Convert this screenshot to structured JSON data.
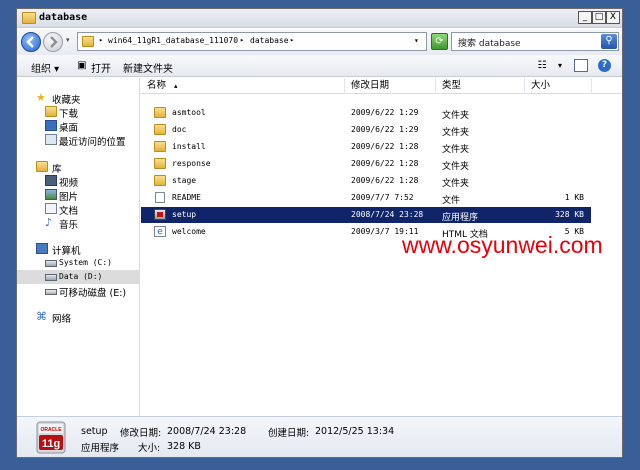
{
  "window": {
    "title": "database",
    "minimize": "_",
    "maximize": "□",
    "close": "X"
  },
  "address": {
    "segments": [
      "win64_11gR1_database_111070",
      "database"
    ]
  },
  "search": {
    "text": "搜索 database"
  },
  "toolbar": {
    "organize": "组织",
    "open": "打开",
    "new_folder": "新建文件夹"
  },
  "nav": {
    "favorites": "收藏夹",
    "downloads": "下载",
    "desktop": "桌面",
    "recent": "最近访问的位置",
    "libraries": "库",
    "videos": "视频",
    "pictures": "图片",
    "documents": "文档",
    "music": "音乐",
    "computer": "计算机",
    "system": "System (C:)",
    "data": "Data (D:)",
    "removable": "可移动磁盘 (E:)",
    "network": "网络"
  },
  "columns": {
    "name": "名称",
    "modified": "修改日期",
    "type": "类型",
    "size": "大小"
  },
  "files": [
    {
      "name": "asmtool",
      "modified": "2009/6/22 1:29",
      "type": "文件夹",
      "size": "",
      "icon": "folder-icon"
    },
    {
      "name": "doc",
      "modified": "2009/6/22 1:29",
      "type": "文件夹",
      "size": "",
      "icon": "folder-icon"
    },
    {
      "name": "install",
      "modified": "2009/6/22 1:28",
      "type": "文件夹",
      "size": "",
      "icon": "folder-icon"
    },
    {
      "name": "response",
      "modified": "2009/6/22 1:28",
      "type": "文件夹",
      "size": "",
      "icon": "folder-icon"
    },
    {
      "name": "stage",
      "modified": "2009/6/22 1:28",
      "type": "文件夹",
      "size": "",
      "icon": "folder-icon"
    },
    {
      "name": "README",
      "modified": "2009/7/7 7:52",
      "type": "文件",
      "size": "1 KB",
      "icon": "file-icon"
    },
    {
      "name": "setup",
      "modified": "2008/7/24 23:28",
      "type": "应用程序",
      "size": "328 KB",
      "icon": "oracle-app-icon"
    },
    {
      "name": "welcome",
      "modified": "2009/3/7 19:11",
      "type": "HTML 文档",
      "size": "5 KB",
      "icon": "html-icon"
    }
  ],
  "selected_file_index": 6,
  "watermark": "www.osyunwei.com",
  "details": {
    "name": "setup",
    "modified_label": "修改日期:",
    "modified": "2008/7/24 23:28",
    "created_label": "创建日期:",
    "created": "2012/5/25 13:34",
    "type": "应用程序",
    "size_label": "大小:",
    "size": "328 KB",
    "icon_text": "11g",
    "icon_brand": "ORACLE"
  },
  "colors": {
    "desktop": "#3a5f98",
    "selection": "#10246a",
    "watermark": "#e8000b"
  }
}
